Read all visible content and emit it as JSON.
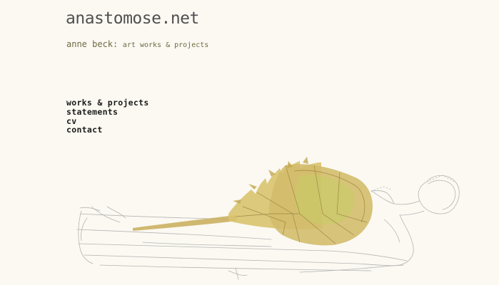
{
  "site": {
    "title": "anastomose.net",
    "subtitle_name": "anne beck:",
    "subtitle_tagline": "art works & projects"
  },
  "nav": {
    "items": [
      {
        "label": "works & projects"
      },
      {
        "label": "statements"
      },
      {
        "label": "cv"
      },
      {
        "label": "contact"
      }
    ]
  },
  "artwork": {
    "subject": "horseshoe crab drawing over pencil figure",
    "colors": {
      "crab_fill": "#d4bf6a",
      "crab_shell": "#c9b057",
      "crab_tail": "#c8ad5a",
      "pencil": "#a9a9a9",
      "background": "#fbf9f2"
    }
  }
}
